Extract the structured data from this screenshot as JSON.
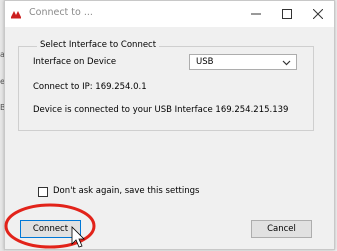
{
  "window": {
    "title": "Connect to ...",
    "minimize_glyph": "—",
    "maximize_glyph": "☐",
    "close_glyph": "✕"
  },
  "group": {
    "legend": "Select Interface to Connect"
  },
  "interface": {
    "label": "Interface on Device",
    "selected": "USB"
  },
  "connect_ip": "Connect to IP: 169.254.0.1",
  "status": "Device is connected to your USB Interface 169.254.215.139",
  "dont_ask": {
    "label": "Don't ask again, save this settings",
    "checked": false
  },
  "buttons": {
    "connect": "Connect",
    "cancel": "Cancel"
  },
  "background_fragments": [
    "a",
    "e",
    "B"
  ],
  "colors": {
    "annotation_circle": "#e2231a",
    "focus_border": "#0078d7",
    "app_icon": "#cc1f1f"
  }
}
